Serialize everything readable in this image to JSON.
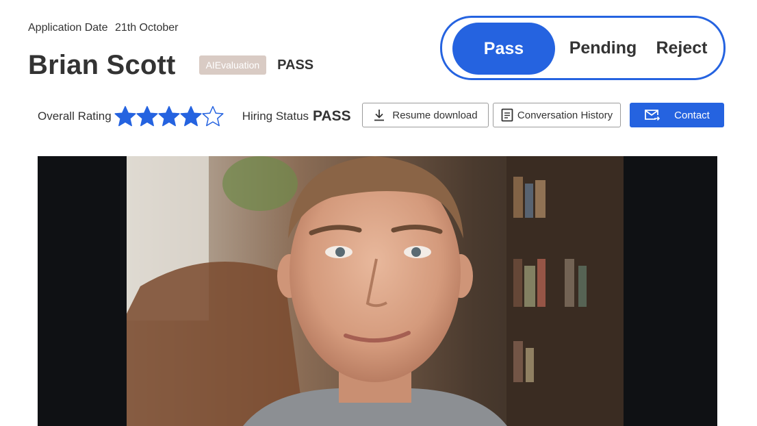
{
  "header": {
    "application_date_label": "Application Date",
    "application_date_value": "21th October",
    "candidate_name": "Brian Scott",
    "evaluation_badge": "AIEvaluation",
    "evaluation_result": "PASS"
  },
  "decision": {
    "options": [
      "Pass",
      "Pending",
      "Reject"
    ],
    "selected": "Pass",
    "accent_color": "#2563e0"
  },
  "rating": {
    "label": "Overall Rating",
    "value": 4,
    "max": 5,
    "star_color": "#2563e0"
  },
  "hiring_status": {
    "label": "Hiring Status",
    "value": "PASS"
  },
  "actions": {
    "resume_download": {
      "label": "Resume download",
      "icon": "download-icon"
    },
    "conversation_history": {
      "label": "Conversation History",
      "icon": "document-icon"
    },
    "contact": {
      "label": "Contact",
      "icon": "mail-icon"
    }
  },
  "photo": {
    "icon": "candidate-photo",
    "background_color": "#0f1114"
  }
}
